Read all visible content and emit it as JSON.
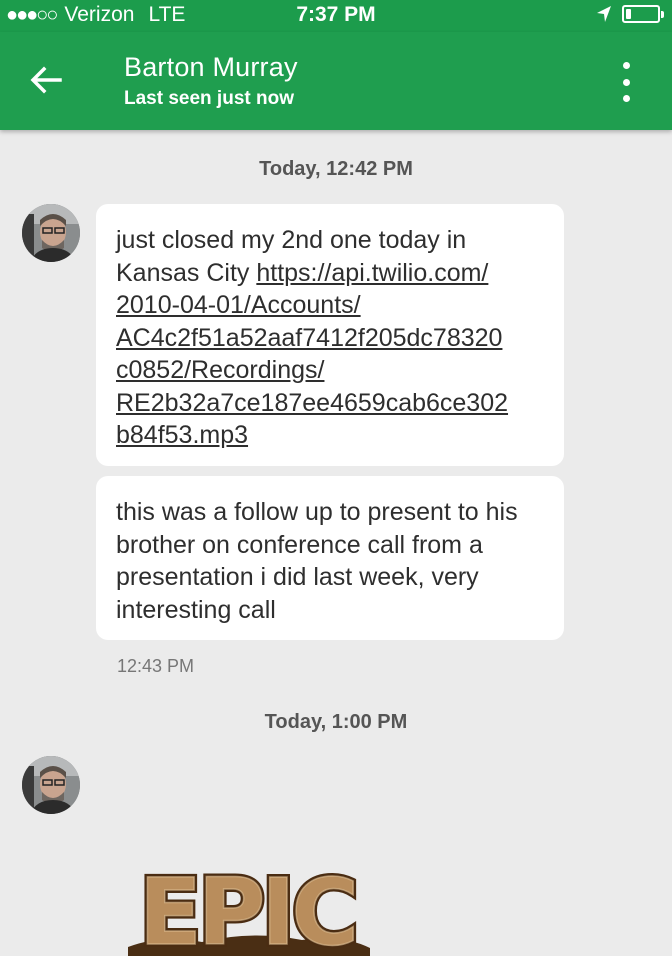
{
  "status_bar": {
    "carrier": "Verizon",
    "network": "LTE",
    "time": "7:37 PM",
    "signal_bars_filled": 3,
    "signal_bars_total": 5,
    "battery_fraction": 0.15
  },
  "header": {
    "title": "Barton Murray",
    "subtitle": "Last seen just now",
    "back_icon": "arrow-left-icon",
    "menu_icon": "more-vert-icon",
    "color": "#1f9e4f"
  },
  "conversation": {
    "separator_1": "Today, 12:42 PM",
    "message_1": {
      "text": "just closed my 2nd one today in Kansas City ",
      "link": "https://api.twilio.com/​2010-04-01/Accounts/​AC4c2f51a52aaf7412f205dc78320​c0852/Recordings/​RE2b32a7ce187ee4659cab6ce302​b84f53.mp3"
    },
    "message_2": {
      "text": "this was a follow up to present to his brother on conference call from a presentation i did last week, very interesting call"
    },
    "message_2_time": "12:43 PM",
    "separator_2": "Today, 1:00 PM",
    "sticker": {
      "text": "EPIC",
      "icon": "epic-sticker"
    }
  }
}
